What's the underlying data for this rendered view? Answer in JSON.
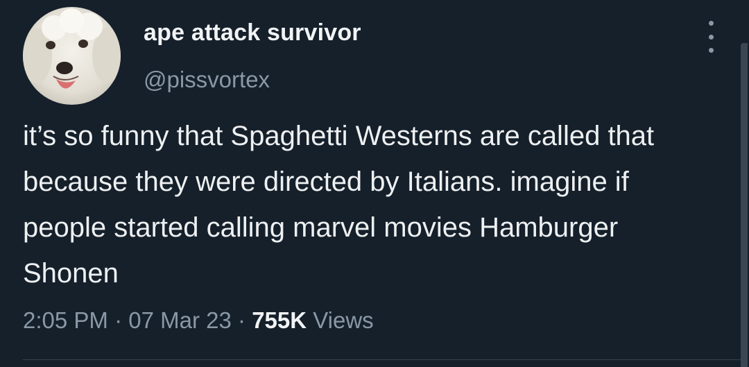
{
  "user": {
    "display_name": "ape attack survivor",
    "handle": "@pissvortex"
  },
  "tweet": {
    "text": "it’s so funny that Spaghetti Westerns are called that because they were directed by Italians. imagine if people started calling marvel movies Hamburger Shonen",
    "time": "2:05 PM",
    "separator": "·",
    "date": "07 Mar 23",
    "views_count": "755K",
    "views_label": "Views"
  },
  "icons": {
    "more": "more-vertical-icon"
  },
  "colors": {
    "background": "#15202b",
    "primary_text": "#e7e9ea",
    "secondary_text": "#8b98a5",
    "divider": "#38444d"
  }
}
